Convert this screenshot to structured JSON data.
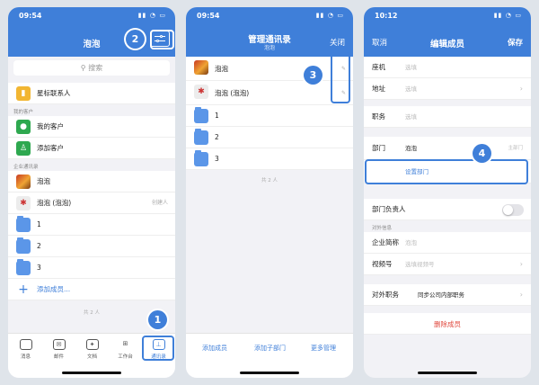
{
  "screen1": {
    "time": "09:54",
    "title": "泡泡",
    "search_placeholder": "搜索",
    "starred": "星标联系人",
    "section_customers": "我的客户",
    "my_customers": "我的客户",
    "add_customer": "添加客户",
    "section_company": "企业通讯录",
    "contacts": [
      {
        "name": "泡泡",
        "tail": ""
      },
      {
        "name": "泡泡 (泡泡)",
        "tail": "创建人"
      }
    ],
    "folders": [
      "1",
      "2",
      "3"
    ],
    "add_member": "添加成员...",
    "count": "共 2 人",
    "tabs": [
      "消息",
      "邮件",
      "文档",
      "工作台",
      "通讯录"
    ]
  },
  "screen2": {
    "time": "09:54",
    "title": "管理通讯录",
    "subtitle": "泡泡",
    "close": "关闭",
    "contacts": [
      "泡泡",
      "泡泡 (泡泡)"
    ],
    "folders": [
      "1",
      "2",
      "3"
    ],
    "count": "共 2 人",
    "actions": [
      "添加成员",
      "添加子部门",
      "更多管理"
    ]
  },
  "screen3": {
    "time": "10:12",
    "title": "编辑成员",
    "cancel": "取消",
    "save": "保存",
    "landline_label": "座机",
    "landline_value": "选填",
    "address_label": "地址",
    "address_value": "选填",
    "position_label": "职务",
    "position_value": "选填",
    "dept_label": "部门",
    "dept_value": "泡泡",
    "dept_tail": "主部门",
    "set_dept": "设置部门",
    "dept_head_label": "部门负责人",
    "external_info": "对外信息",
    "short_name_label": "企业简称",
    "short_name_value": "泡泡",
    "video_label": "视频号",
    "video_value": "选填视频号",
    "ext_position_label": "对外职务",
    "ext_position_value": "同步公司内部职务",
    "delete": "删除成员"
  },
  "steps": [
    "1",
    "2",
    "3",
    "4"
  ],
  "colors": {
    "accent": "#3f7fd9",
    "danger": "#e0493e",
    "background": "#dfe4ea"
  }
}
